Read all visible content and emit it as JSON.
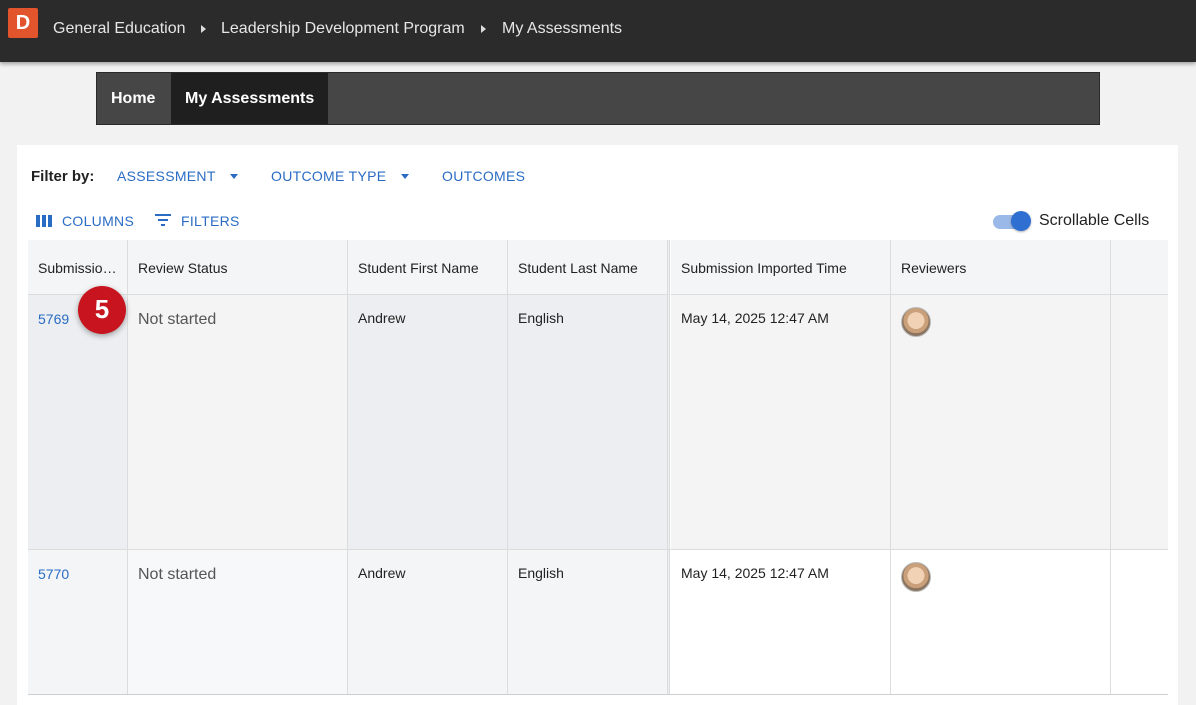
{
  "logo": {
    "letter": "D",
    "color": "#e2542b"
  },
  "breadcrumb": [
    "General Education",
    "Leadership Development Program",
    "My Assessments"
  ],
  "nav": {
    "tabs": [
      {
        "label": "Home",
        "active": false
      },
      {
        "label": "My Assessments",
        "active": true
      }
    ]
  },
  "filters": {
    "label": "Filter by:",
    "items": [
      {
        "label": "ASSESSMENT",
        "dropdown": true
      },
      {
        "label": "OUTCOME TYPE",
        "dropdown": true
      },
      {
        "label": "OUTCOMES",
        "dropdown": false
      }
    ]
  },
  "toolbar": {
    "columns_label": "COLUMNS",
    "filters_label": "FILTERS",
    "toggle_label": "Scrollable Cells",
    "toggle_on": true
  },
  "table": {
    "columns": [
      "Submissio…",
      "Review Status",
      "Student First Name",
      "Student Last Name",
      "Submission Imported Time",
      "Reviewers"
    ],
    "rows": [
      {
        "id": "5769",
        "status": "Not started",
        "first_name": "Andrew",
        "last_name": "English",
        "imported": "May 14, 2025 12:47 AM",
        "reviewer": "avatar"
      },
      {
        "id": "5770",
        "status": "Not started",
        "first_name": "Andrew",
        "last_name": "English",
        "imported": "May 14, 2025 12:47 AM",
        "reviewer": "avatar"
      }
    ]
  },
  "callout": {
    "number": "5",
    "color": "#c8141e"
  },
  "colors": {
    "accent": "#2a6cc4",
    "topbar": "#2b2b2c"
  }
}
